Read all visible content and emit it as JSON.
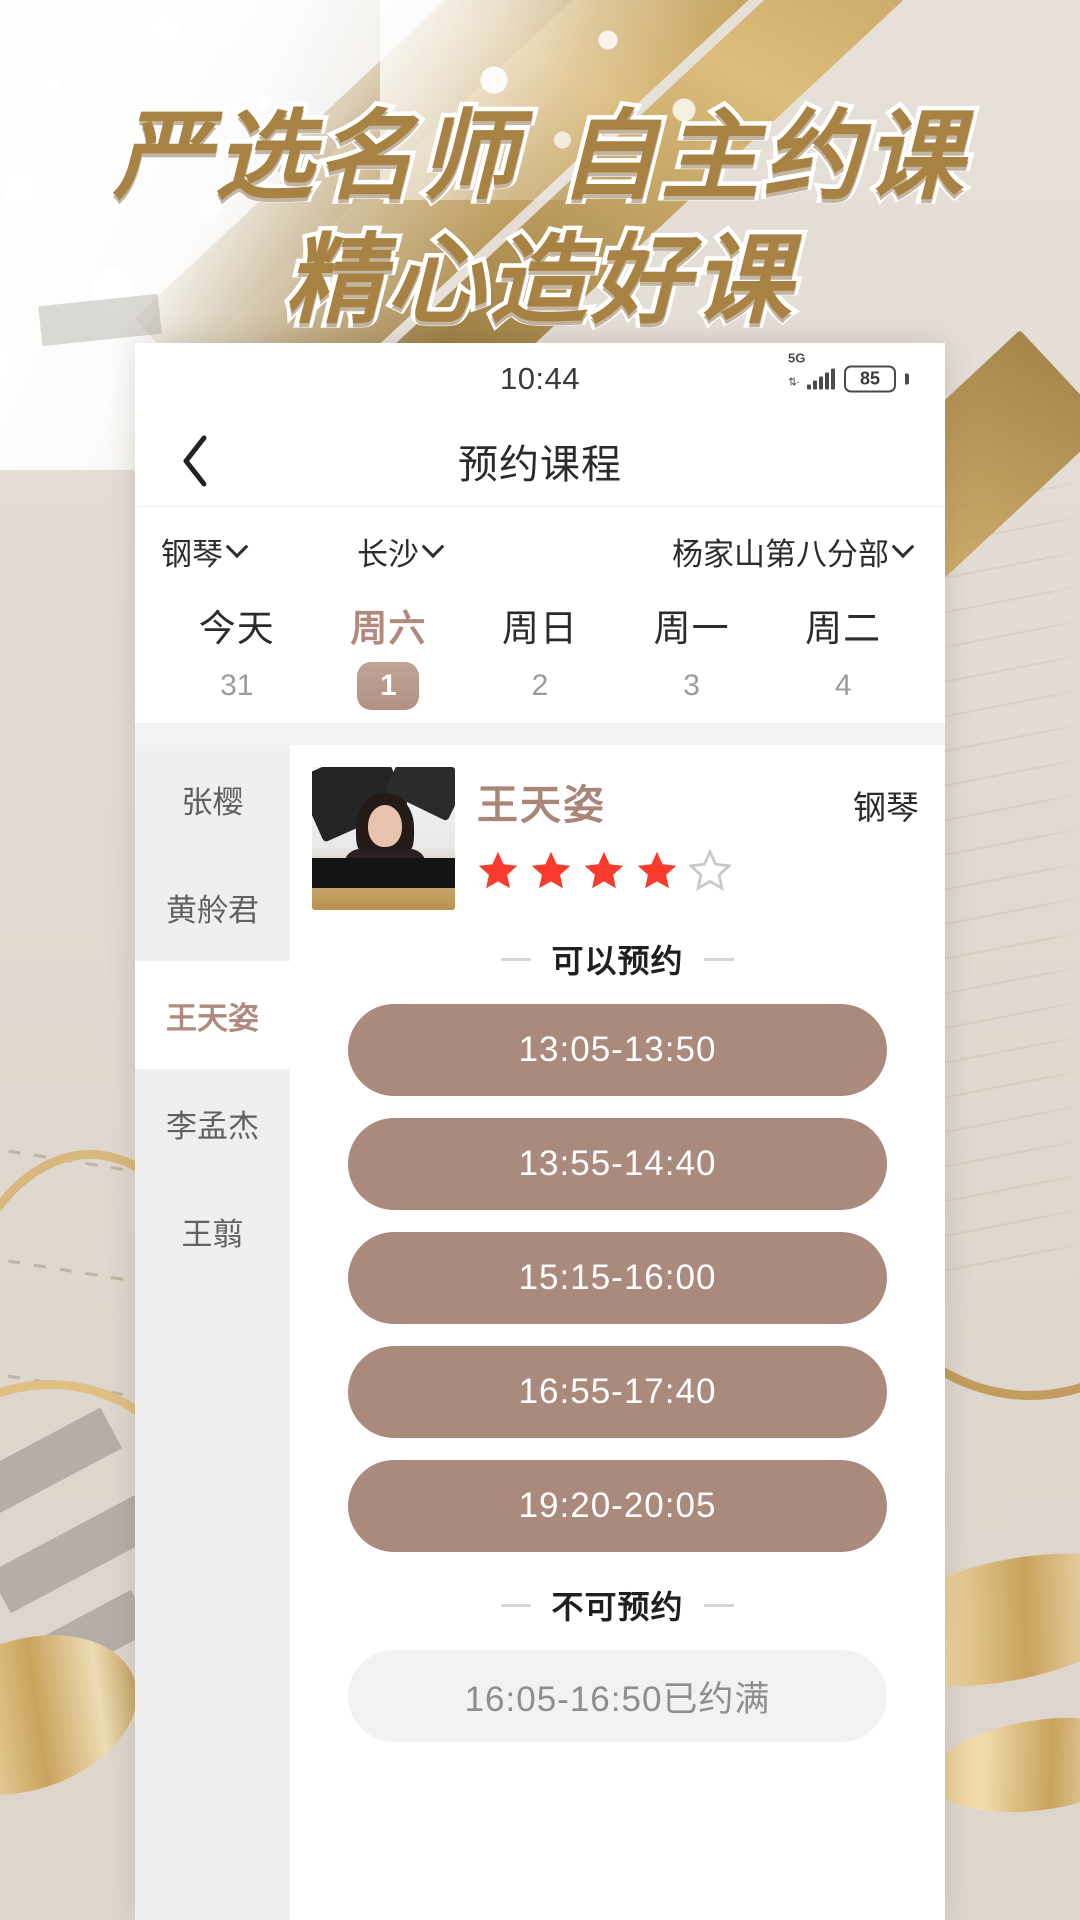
{
  "poster": {
    "headline_line1": "严选名师 自主约课",
    "headline_line2": "精心造好课",
    "headline_color": "#a88243"
  },
  "statusbar": {
    "time": "10:44",
    "network": "5G",
    "battery": "85"
  },
  "navbar": {
    "back_icon": "chevron-left-icon",
    "title": "预约课程"
  },
  "filters": [
    {
      "label": "钢琴",
      "icon": "chevron-down-icon"
    },
    {
      "label": "长沙",
      "icon": "chevron-down-icon"
    },
    {
      "label": "杨家山第八分部",
      "icon": "chevron-down-icon"
    }
  ],
  "dates": [
    {
      "week": "今天",
      "day": "31",
      "active": false
    },
    {
      "week": "周六",
      "day": "1",
      "active": true
    },
    {
      "week": "周日",
      "day": "2",
      "active": false
    },
    {
      "week": "周一",
      "day": "3",
      "active": false
    },
    {
      "week": "周二",
      "day": "4",
      "active": false
    }
  ],
  "teachers": [
    {
      "name": "张樱",
      "active": false
    },
    {
      "name": "黄舲君",
      "active": false
    },
    {
      "name": "王天姿",
      "active": true
    },
    {
      "name": "李孟杰",
      "active": false
    },
    {
      "name": "王翦",
      "active": false
    }
  ],
  "teacher_detail": {
    "name": "王天姿",
    "subject": "钢琴",
    "rating": 4,
    "rating_max": 5,
    "star_color": "#f93b2e",
    "star_empty_color": "#cccccc",
    "avatar_icon": "teacher-photo"
  },
  "available_section": {
    "label": "可以预约",
    "slots": [
      "13:05-13:50",
      "13:55-14:40",
      "15:15-16:00",
      "16:55-17:40",
      "19:20-20:05"
    ]
  },
  "unavailable_section": {
    "label": "不可预约",
    "slots": [
      "16:05-16:50已约满"
    ]
  },
  "colors": {
    "accent": "#b08a7c",
    "slot_bg": "#ab8a7e",
    "gold": "#a88243",
    "page_bg": "#e3ddd6"
  }
}
